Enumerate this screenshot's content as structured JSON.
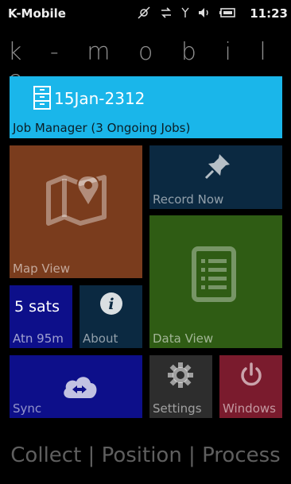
{
  "statusbar": {
    "app_name": "K-Mobile",
    "time": "11:23",
    "icons": [
      "satellite-off-icon",
      "data-transfer-icon",
      "signal-icon",
      "volume-icon",
      "battery-icon"
    ]
  },
  "app_title": "k - m o b i l e",
  "tiles": {
    "job_manager": {
      "date": "15Jan-2312",
      "label": "Job Manager (3 Ongoing Jobs)",
      "icon": "file-cabinet-icon"
    },
    "map_view": {
      "label": "Map View",
      "icon": "map-pin-icon"
    },
    "record_now": {
      "label": "Record Now",
      "icon": "push-pin-icon"
    },
    "data_view": {
      "label": "Data View",
      "icon": "document-list-icon"
    },
    "sats": {
      "value": "5 sats",
      "label": "Atn 95m"
    },
    "about": {
      "label": "About",
      "icon": "info-icon"
    },
    "sync": {
      "label": "Sync",
      "icon": "cloud-sync-icon"
    },
    "settings": {
      "label": "Settings",
      "icon": "gear-icon"
    },
    "windows": {
      "label": "Windows",
      "icon": "power-icon"
    }
  },
  "footer": "Collect | Position | Process",
  "colors": {
    "job_manager": "#1ab6ea",
    "map_view": "#7a3c1d",
    "record_now": "#0b2941",
    "data_view": "#2f5c14",
    "sats": "#0d0f8a",
    "about": "#0b2941",
    "sync": "#0d0f8a",
    "settings": "#2d2d2d",
    "windows": "#7a1b2d"
  }
}
